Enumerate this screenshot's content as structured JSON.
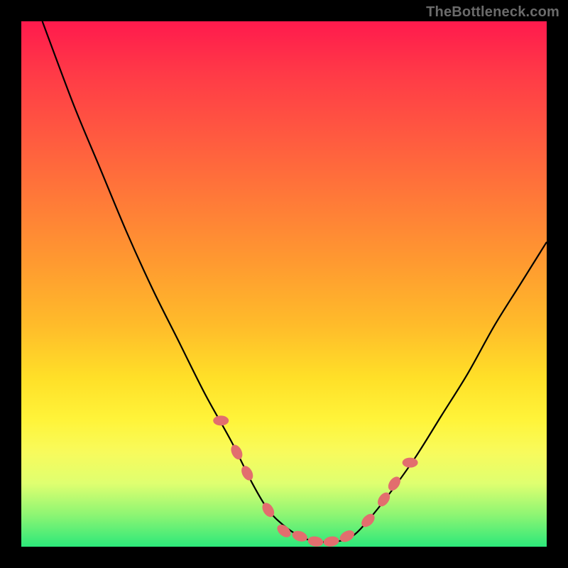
{
  "watermark": "TheBottleneck.com",
  "colors": {
    "frame": "#000000",
    "line": "#000000",
    "marker": "#e26e6e",
    "gradient_top": "#ff1a4d",
    "gradient_bottom": "#2ce87a"
  },
  "chart_data": {
    "type": "line",
    "title": "",
    "xlabel": "",
    "ylabel": "",
    "xlim": [
      0,
      100
    ],
    "ylim": [
      0,
      100
    ],
    "grid": false,
    "legend": false,
    "series": [
      {
        "name": "curve",
        "x": [
          4,
          10,
          15,
          20,
          25,
          30,
          35,
          40,
          44,
          47,
          50,
          53,
          56,
          60,
          63,
          66,
          70,
          75,
          80,
          85,
          90,
          95,
          100
        ],
        "y": [
          100,
          84,
          72,
          60,
          49,
          39,
          29,
          20,
          12,
          7,
          4,
          2,
          1,
          1,
          2,
          5,
          10,
          17,
          25,
          33,
          42,
          50,
          58
        ]
      }
    ],
    "markers": {
      "name": "highlight-points",
      "x": [
        38,
        41,
        43,
        47,
        50,
        53,
        56,
        59,
        62,
        66,
        69,
        71,
        74
      ],
      "y": [
        24,
        18,
        14,
        7,
        3,
        2,
        1,
        1,
        2,
        5,
        9,
        12,
        16
      ]
    }
  }
}
